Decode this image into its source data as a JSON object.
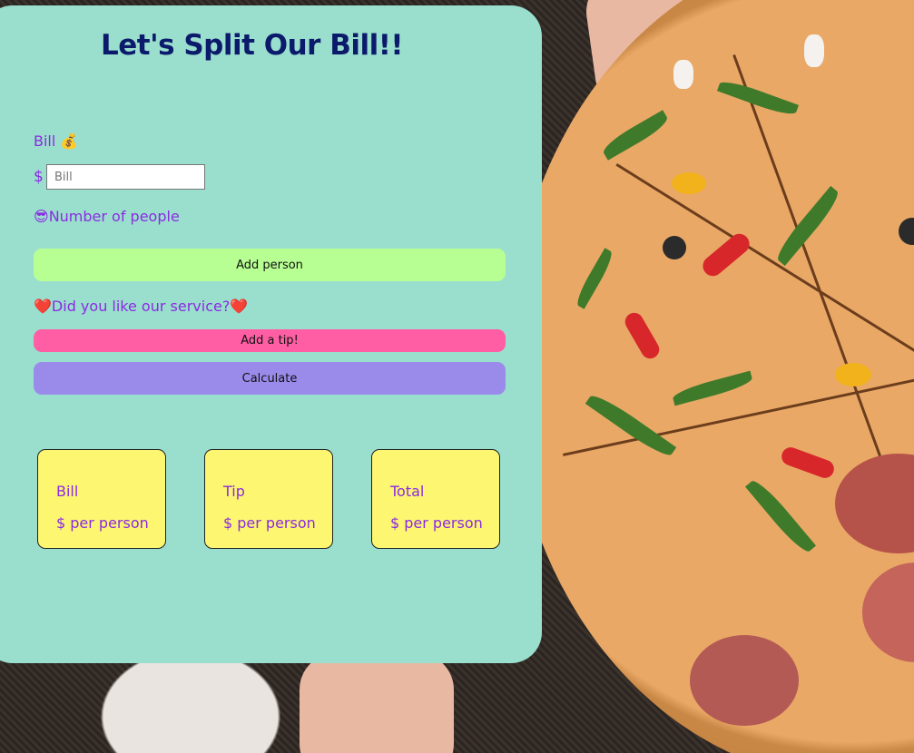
{
  "header": {
    "title": "Let's Split Our Bill!!"
  },
  "bill": {
    "label": "Bill",
    "icon": "money-bag-icon",
    "icon_glyph": "💰",
    "currency": "$",
    "placeholder": "Bill",
    "value": ""
  },
  "people": {
    "icon": "sunglasses-face-icon",
    "icon_glyph": "😎",
    "label": "Number of people",
    "add_button": "Add person"
  },
  "tip": {
    "heart_glyph": "❤️",
    "question": "Did you like our service?",
    "add_button": "Add a tip!"
  },
  "calculate": {
    "button": "Calculate"
  },
  "results": [
    {
      "title": "Bill",
      "value": "$ per person"
    },
    {
      "title": "Tip",
      "value": "$ per person"
    },
    {
      "title": "Total",
      "value": "$ per person"
    }
  ],
  "colors": {
    "card_bg": "#9adfcd",
    "title": "#0b1a6b",
    "label": "#8a2be2",
    "add_person_btn": "#b7ff92",
    "tip_btn": "#ff5ea4",
    "calc_btn": "#9a8beb",
    "result_bg": "#fdf671"
  }
}
